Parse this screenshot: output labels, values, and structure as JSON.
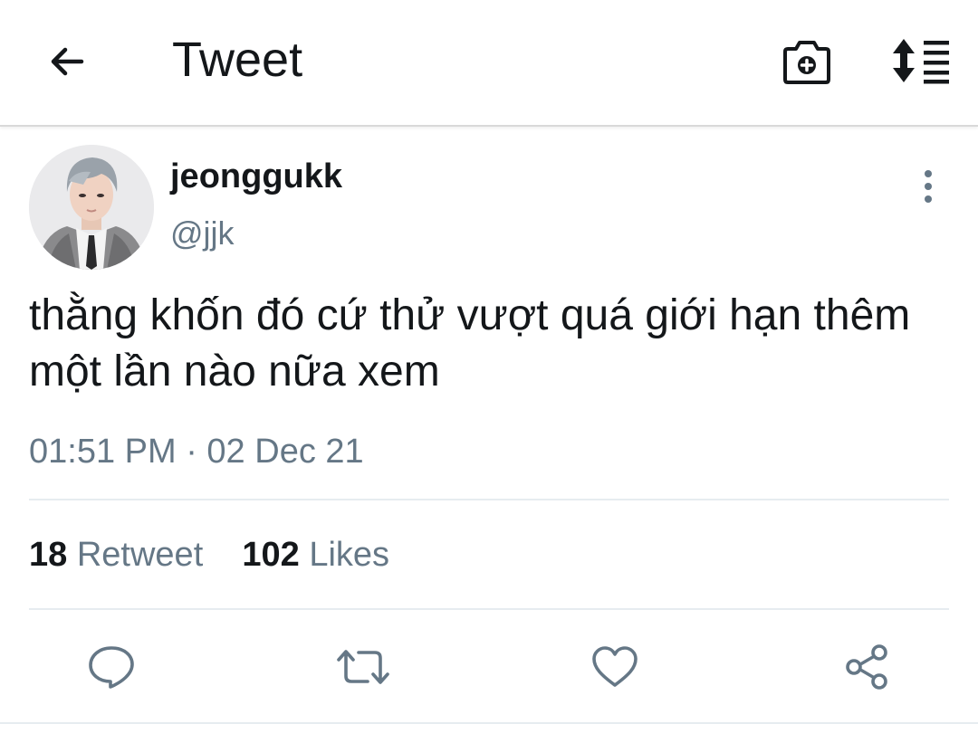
{
  "header": {
    "title": "Tweet",
    "back_icon": "arrow-left-icon",
    "camera_icon": "camera-plus-icon",
    "sort_icon": "sort-lines-icon"
  },
  "tweet": {
    "display_name": "jeonggukk",
    "handle": "@jjk",
    "text": "thằng khốn đó cứ thử vượt quá giới hạn thêm một lần nào nữa xem",
    "timestamp": "01:51 PM · 02 Dec 21",
    "more_icon": "more-vertical-icon"
  },
  "stats": {
    "retweets_count": "18",
    "retweets_label": "Retweet",
    "likes_count": "102",
    "likes_label": "Likes"
  },
  "actions": {
    "reply_icon": "reply-icon",
    "retweet_icon": "retweet-icon",
    "like_icon": "heart-icon",
    "share_icon": "share-icon"
  },
  "colors": {
    "text_primary": "#14171a",
    "text_secondary": "#657786",
    "divider": "#e6ecf0",
    "icon": "#657786"
  }
}
